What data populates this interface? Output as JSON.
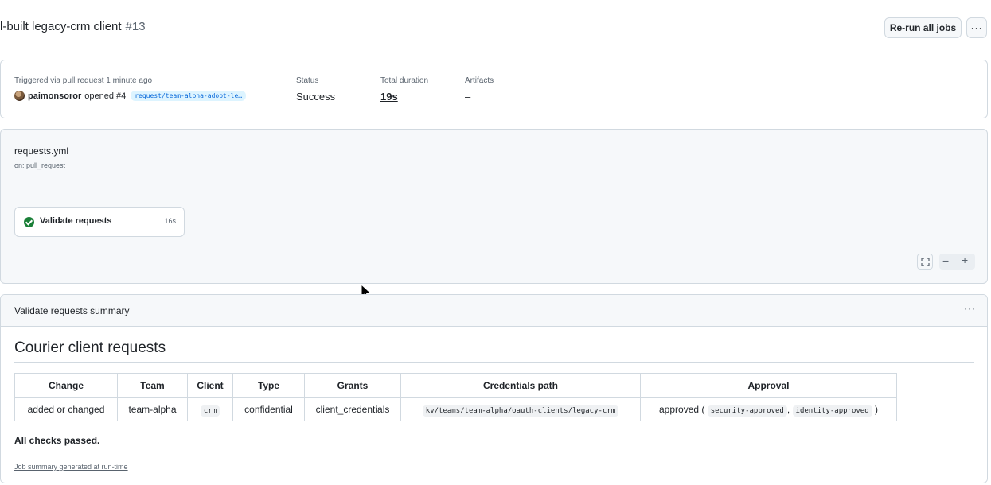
{
  "header": {
    "title": "l-built legacy-crm client",
    "run_number": "#13",
    "rerun_label": "Re-run all jobs",
    "more_label": "···"
  },
  "run_summary": {
    "trigger_label": "Triggered via pull request 1 minute ago",
    "user": "paimonsoror",
    "opened_text": "opened #4",
    "branch": "request/team-alpha-adopt-le…",
    "status_label": "Status",
    "status_value": "Success",
    "duration_label": "Total duration",
    "duration_value": "19s",
    "artifacts_label": "Artifacts",
    "artifacts_value": "–"
  },
  "workflow": {
    "file": "requests.yml",
    "trigger": "on: pull_request",
    "job_name": "Validate requests",
    "job_duration": "16s",
    "status_color": "#1a7f37"
  },
  "graph_controls": {
    "fullscreen_icon": "⛶",
    "minus": "−",
    "plus": "+"
  },
  "job_summary": {
    "title": "Validate requests summary",
    "more_label": "···",
    "heading": "Courier client requests",
    "columns": [
      "Change",
      "Team",
      "Client",
      "Type",
      "Grants",
      "Credentials path",
      "Approval"
    ],
    "row": {
      "change": "added or changed",
      "team": "team-alpha",
      "client": "crm",
      "type": "confidential",
      "grants": "client_credentials",
      "credentials_path": "kv/teams/team-alpha/oauth-clients/legacy-crm",
      "approval_prefix": "approved (",
      "approval_tag_1": "security-approved",
      "approval_sep": ",",
      "approval_tag_2": "identity-approved",
      "approval_suffix": ")"
    },
    "result": "All checks passed.",
    "footer": "Job summary generated at run-time"
  }
}
